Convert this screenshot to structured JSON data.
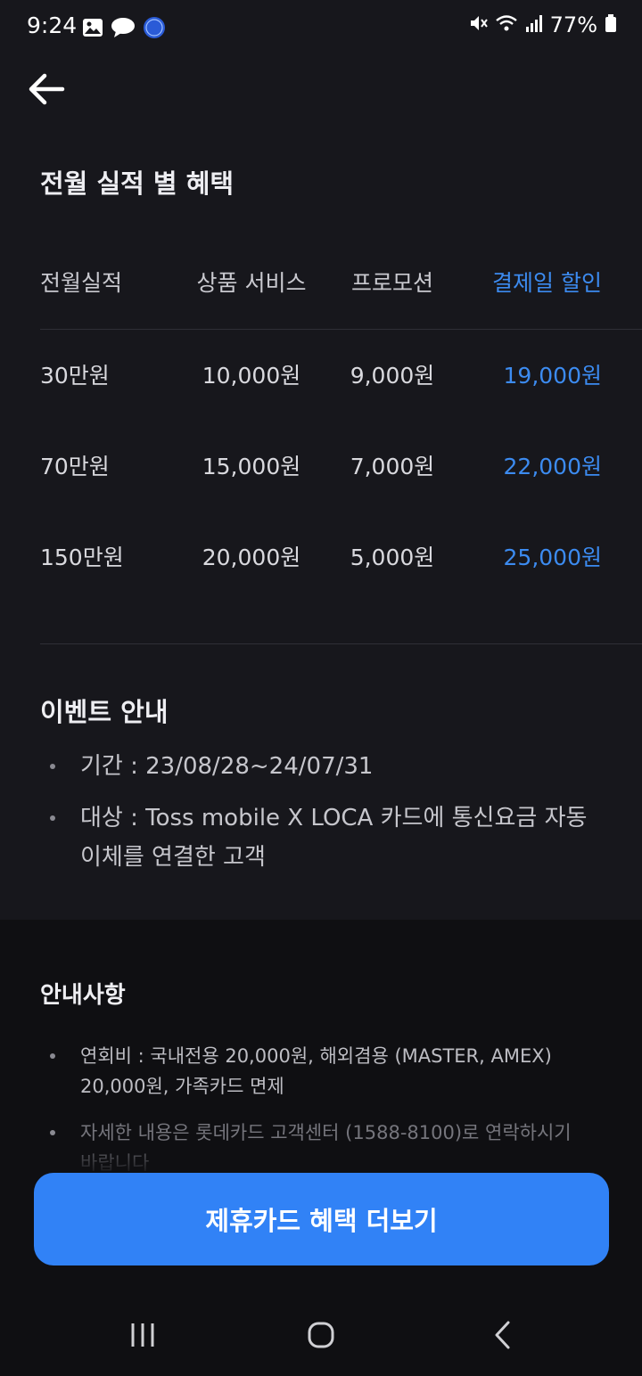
{
  "status_bar": {
    "time": "9:24",
    "battery": "77%"
  },
  "title": "전월 실적 별 혜택",
  "table": {
    "headers": [
      "전월실적",
      "상품 서비스",
      "프로모션",
      "결제일 할인"
    ],
    "rows": [
      [
        "30만원",
        "10,000원",
        "9,000원",
        "19,000원"
      ],
      [
        "70만원",
        "15,000원",
        "7,000원",
        "22,000원"
      ],
      [
        "150만원",
        "20,000원",
        "5,000원",
        "25,000원"
      ]
    ]
  },
  "event": {
    "title": "이벤트 안내",
    "items": [
      "기간 : 23/08/28~24/07/31",
      "대상 : Toss mobile X LOCA 카드에 통신요금 자동이체를 연결한 고객"
    ]
  },
  "notice": {
    "title": "안내사항",
    "items": [
      "연회비 : 국내전용 20,000원, 해외겸용 (MASTER, AMEX) 20,000원, 가족카드 면제",
      "자세한 내용은 롯데카드 고객센터 (1588-8100)로 연락하시기 바랍니다"
    ]
  },
  "cta": {
    "label": "제휴카드 혜택 더보기"
  },
  "colors": {
    "accent": "#3182f6",
    "highlight_text": "#3c8bf0",
    "background": "#17171c",
    "panel": "#0f0f12"
  },
  "icons": {
    "status_left": [
      "gallery-icon",
      "chat-bubble-icon",
      "super-sol-app-icon"
    ],
    "status_right": [
      "mute-icon",
      "wifi-icon",
      "signal-icon",
      "battery-icon"
    ],
    "back": "arrow-left-icon",
    "nav": [
      "recent-apps-icon",
      "home-icon",
      "back-nav-icon"
    ]
  }
}
